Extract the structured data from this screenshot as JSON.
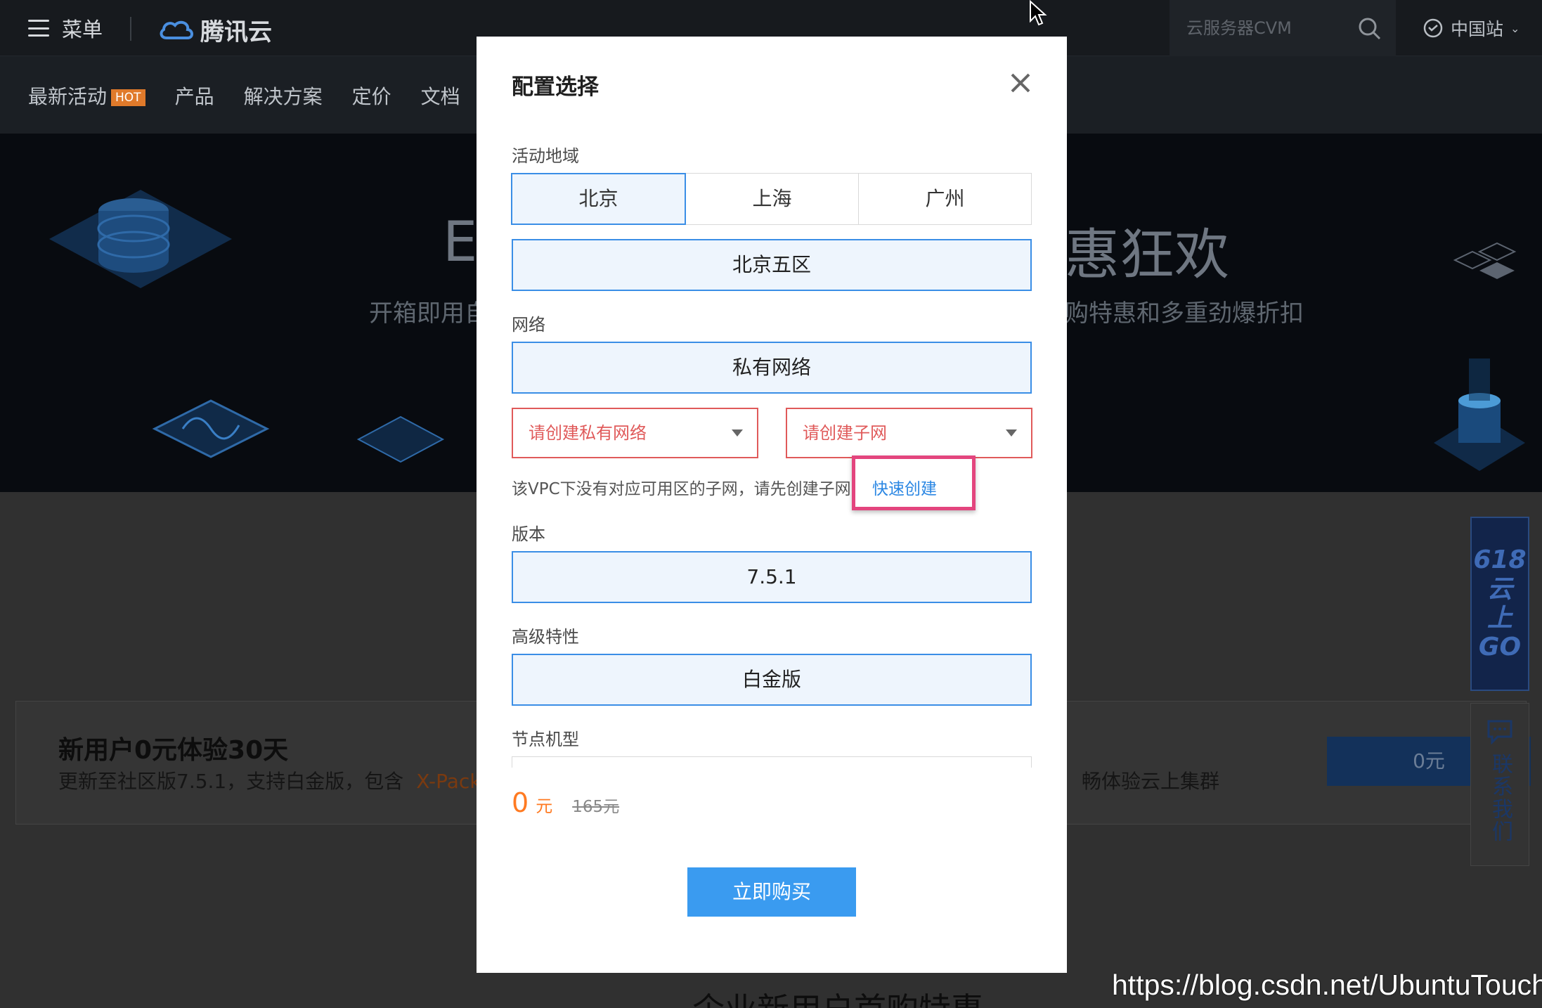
{
  "header": {
    "menu_label": "菜单",
    "logo_text": "腾讯云",
    "search_placeholder": "云服务器CVM",
    "region_label": "中国站"
  },
  "nav": {
    "items": [
      {
        "label": "最新活动",
        "badge": "HOT"
      },
      {
        "label": "产品"
      },
      {
        "label": "解决方案"
      },
      {
        "label": "定价"
      },
      {
        "label": "文档"
      }
    ]
  },
  "banner": {
    "title_left": "E",
    "title_right": "惠狂欢",
    "subtitle_left": "开箱即用自",
    "subtitle_right": "购特惠和多重劲爆折扣"
  },
  "promo": {
    "title": "新用户0元体验30天",
    "desc": "更新至社区版7.5.1，支持白金版，包含",
    "desc_highlight": "X-Pack",
    "desc_right": "畅体验云上集群",
    "button": "0元"
  },
  "bottom_heading": "企业新用户首购特惠",
  "side": {
    "badge_lines": [
      "618",
      "云",
      "上",
      "GO"
    ],
    "contact_label": "联系我们"
  },
  "watermark": "https://blog.csdn.net/UbuntuTouch",
  "modal": {
    "title": "配置选择",
    "region_label": "活动地域",
    "regions": [
      "北京",
      "上海",
      "广州"
    ],
    "selected_region": "北京",
    "zone": "北京五区",
    "network_label": "网络",
    "network": "私有网络",
    "vpc_select": "请创建私有网络",
    "subnet_select": "请创建子网",
    "hint": "该VPC下没有对应可用区的子网，请先创建子网",
    "quick_create": "快速创建",
    "version_label": "版本",
    "version": "7.5.1",
    "feature_label": "高级特性",
    "feature": "白金版",
    "node_label": "节点机型",
    "price": "0",
    "price_unit": "元",
    "original_price": "165元",
    "buy_button": "立即购买"
  },
  "colors": {
    "accent": "#3a8ee6",
    "error": "#e05a5a",
    "price": "#ff7a21",
    "highlight": "#e3457e",
    "buy_button": "#3a9bf0"
  }
}
